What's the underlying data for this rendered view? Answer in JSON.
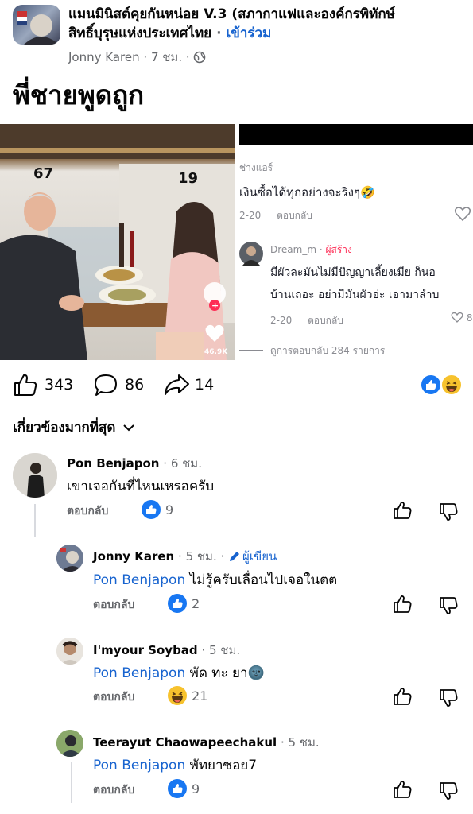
{
  "post": {
    "group_name_line1": "แมนมินิสต์คุยกันหน่อย V.3 (สภากาแฟและองค์กรพิทักษ์",
    "group_name_line2": "สิทธิ์บุรุษแห่งประเทศไทย",
    "join_label": "เข้าร่วม",
    "author": "Jonny Karen",
    "time": "7 ชม.",
    "title": "พี่ชายพูดถูก"
  },
  "media": {
    "left": {
      "age_left": "67",
      "age_right": "19",
      "like_count": "46.9K"
    },
    "right": {
      "top_user": "ช่างแอร์",
      "top_comment": "เงินซื้อได้ทุกอย่างจะริงๆ🤣",
      "top_date": "2-20",
      "top_reply": "ตอบกลับ",
      "reply_user": "Dream_m",
      "creator_badge": "ผู้สร้าง",
      "reply_line1": "มีผัวละมันไม่มีปัญญาเลี้ยงเมีย ก็นอ",
      "reply_line2": "บ้านเถอะ อย่ามีมันผัวอ่ะ เอามาลำบ",
      "reply_date": "2-20",
      "reply_reply": "ตอบกลับ",
      "reply_likes": "8",
      "view_replies": "ดูการตอบกลับ 284 รายการ"
    }
  },
  "actions": {
    "likes": "343",
    "comments": "86",
    "shares": "14"
  },
  "sort_label": "เกี่ยวข้องมากที่สุด",
  "comments": [
    {
      "name": "Pon Benjapon",
      "time": "6 ชม.",
      "text": "เขาเจอกันที่ไหนเหรอครับ",
      "reply": "ตอบกลับ",
      "reaction_count": "9"
    },
    {
      "name": "Jonny Karen",
      "time": "5 ชม.",
      "badge": "ผู้เขียน",
      "mention": "Pon Benjapon",
      "text": "ไม่รู้ครับเลื่อนไปเจอในตต",
      "reply": "ตอบกลับ",
      "reaction_count": "2"
    },
    {
      "name": "I'myour Soybad",
      "time": "5 ชม.",
      "mention": "Pon Benjapon",
      "text": "พัด ทะ ยา🌚",
      "reply": "ตอบกลับ",
      "reaction_count": "21"
    },
    {
      "name": "Teerayut Chaowapeechakul",
      "time": "5 ชม.",
      "mention": "Pon Benjapon",
      "text": "พัทยาซอย7",
      "reply": "ตอบกลับ",
      "reaction_count": "9"
    }
  ],
  "colors": {
    "link": "#1763cf",
    "like_blue": "#1877f2",
    "muted": "#65676b"
  }
}
